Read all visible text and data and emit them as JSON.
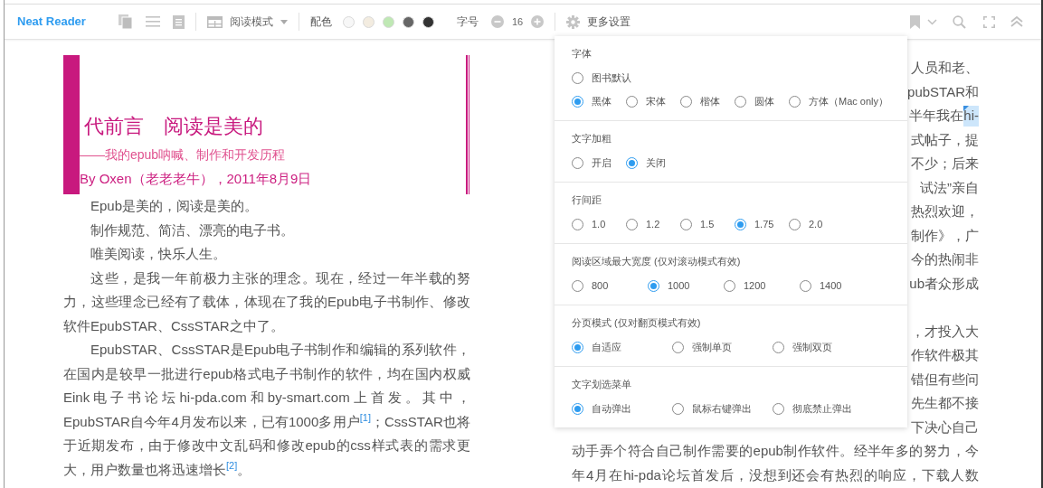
{
  "toolbar": {
    "app_name": "Neat Reader",
    "reading_mode": {
      "label": "阅读模式"
    },
    "color_scheme": {
      "label": "配色",
      "swatches": [
        {
          "color": "#f7f7f7"
        },
        {
          "color": "#f3ece0"
        },
        {
          "color": "#bfe8b4"
        },
        {
          "color": "#666666"
        },
        {
          "color": "#333333"
        }
      ]
    },
    "font_size": {
      "label": "字号",
      "value": "16"
    },
    "more_settings": {
      "label": "更多设置"
    }
  },
  "left_page": {
    "title": "代前言　阅读是美的",
    "subtitle": "——我的epub呐喊、制作和开发历程",
    "byline": "By Oxen（老老老牛），2011年8月9日",
    "paragraphs": [
      {
        "text": "Epub是美的，阅读是美的。"
      },
      {
        "text": "制作规范、简洁、漂亮的电子书。"
      },
      {
        "text": "唯美阅读，快乐人生。"
      },
      {
        "text": "这些，是我一年前极力主张的理念。现在，经过一年半载的努力，这些理念已经有了载体，体现在了我的Epub电子书制作、修改软件EpubSTAR、CssSTAR之中了。"
      },
      {
        "text": "EpubSTAR、CssSTAR是Epub电子书制作和编辑的系列软件，在国内是较早一批进行epub格式电子书制作的软件，均在国内权威Eink电子书论坛hi-pda.com和by-smart.com上首发。其中，EpubSTAR自今年4月发布以来，已有1000多用户$^{[1]}$；CssSTAR也将于近期发布，由于修改中文乱码和修改epub的css样式表的需求更大，用户数量也将迅速增长$^{[2]}$。"
      }
    ]
  },
  "right_page": {
    "blocks": [
      [
        {
          "text": "人员和老、"
        },
        {
          "text": "pubSTAR和"
        },
        {
          "text": "半年我在",
          "selected_text": "hi-"
        },
        {
          "text": "式帖子，提"
        },
        {
          "text": "不少；后来"
        },
        {
          "text": "试法”亲自"
        },
        {
          "text": "热烈欢迎，"
        },
        {
          "text": "制作》，广"
        },
        {
          "text": "今的热闹非"
        },
        {
          "text": "ub者众形成"
        }
      ],
      [
        {
          "text": "，才投入大"
        },
        {
          "text": "作软件极其"
        },
        {
          "text": "错但有些问"
        },
        {
          "text": "先生都不接"
        },
        {
          "text": "下决心自己"
        }
      ]
    ],
    "full_lines": [
      {
        "text": "动手弄个符合自己制作需要的epub制作软件。经半年多的努力，今"
      },
      {
        "text": "年4月在hi-pda论坛首发后，没想到还会有热烈的响应，下载人数"
      }
    ]
  },
  "settings_panel": {
    "sections": [
      {
        "title": "字体",
        "rows": [
          [
            {
              "label": "图书默认",
              "selected": false
            }
          ],
          [
            {
              "label": "黑体",
              "selected": true
            },
            {
              "label": "宋体",
              "selected": false
            },
            {
              "label": "楷体",
              "selected": false
            },
            {
              "label": "圆体",
              "selected": false
            },
            {
              "label": "方体（Mac only）",
              "selected": false
            }
          ]
        ]
      },
      {
        "title": "文字加粗",
        "rows": [
          [
            {
              "label": "开启",
              "selected": false
            },
            {
              "label": "关闭",
              "selected": true
            }
          ]
        ]
      },
      {
        "title": "行间距",
        "rows": [
          [
            {
              "label": "1.0",
              "selected": false
            },
            {
              "label": "1.2",
              "selected": false
            },
            {
              "label": "1.5",
              "selected": false
            },
            {
              "label": "1.75",
              "selected": true
            },
            {
              "label": "2.0",
              "selected": false
            }
          ]
        ]
      },
      {
        "title": "阅读区域最大宽度 (仅对滚动模式有效)",
        "rows": [
          [
            {
              "label": "800",
              "selected": false
            },
            {
              "label": "1000",
              "selected": true
            },
            {
              "label": "1200",
              "selected": false
            },
            {
              "label": "1400",
              "selected": false
            }
          ]
        ]
      },
      {
        "title": "分页模式 (仅对翻页模式有效)",
        "rows": [
          [
            {
              "label": "自适应",
              "selected": true
            },
            {
              "label": "强制单页",
              "selected": false
            },
            {
              "label": "强制双页",
              "selected": false
            }
          ]
        ]
      },
      {
        "title": "文字划选菜单",
        "rows": [
          [
            {
              "label": "自动弹出",
              "selected": true
            },
            {
              "label": "鼠标右键弹出",
              "selected": false
            },
            {
              "label": "彻底禁止弹出",
              "selected": false
            }
          ]
        ]
      }
    ]
  }
}
